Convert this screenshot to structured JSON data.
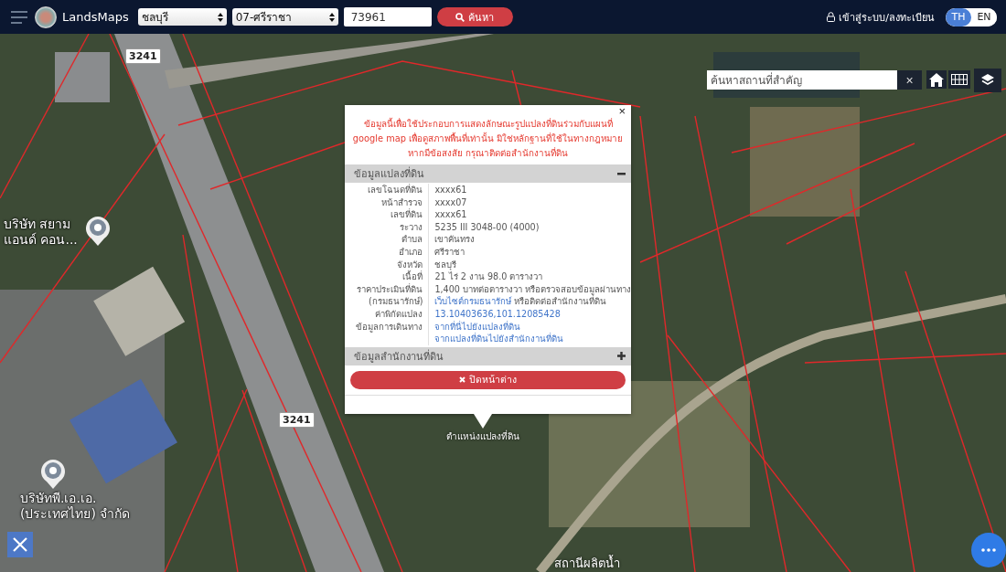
{
  "header": {
    "logo_text": "LandsMaps",
    "province_select": "ชลบุรี",
    "district_select": "07-ศรีราชา",
    "parcel_field": "73961",
    "search_button": "ค้นหา",
    "login_link": "เข้าสู่ระบบ/ลงทะเบียน",
    "languages": [
      {
        "label": "TH",
        "selected": true
      },
      {
        "label": "EN",
        "selected": false
      }
    ]
  },
  "map": {
    "place_search": {
      "placeholder": "ค้นหาสถานที่สำคัญ",
      "clear": "×"
    },
    "labels": [
      {
        "kind": "road",
        "text": "3241"
      },
      {
        "kind": "poi",
        "text": "บริษัท สยาม แอนด์ คอน..."
      },
      {
        "kind": "road",
        "text": "3241"
      },
      {
        "kind": "poi",
        "text": "บริษัทพี.เอ.เอ. (ประเทศไทย) จำกัด"
      },
      {
        "kind": "place",
        "text": "สถานีผลิตน้ำ"
      }
    ],
    "marker_label": "ตำแหน่งแปลงที่ดิน"
  },
  "popup": {
    "close": "×",
    "notice": "ข้อมูลนี้เพื่อใช้ประกอบการแสดงลักษณะรูปแปลงที่ดินร่วมกับแผนที่ google map เพื่อดูสภาพพื้นที่เท่านั้น มิใช่หลักฐานที่ใช้ในทางกฎหมาย หากมีข้อสงสัย กรุณาติดต่อสำนักงานที่ดิน",
    "sections": [
      {
        "title": "ข้อมูลแปลงที่ดิน",
        "expanded": true,
        "rows": [
          {
            "label": "เลขโฉนดที่ดิน",
            "value": [
              {
                "kind": "text",
                "text": "xxxx61"
              }
            ]
          },
          {
            "label": "หน้าสำรวจ",
            "value": [
              {
                "kind": "text",
                "text": "xxxx07"
              }
            ]
          },
          {
            "label": "เลขที่ดิน",
            "value": [
              {
                "kind": "text",
                "text": "xxxx61"
              }
            ]
          },
          {
            "label": "ระวาง",
            "value": [
              {
                "kind": "text",
                "text": "5235 III 3048-00 (4000)"
              }
            ]
          },
          {
            "label": "ตำบล",
            "value": [
              {
                "kind": "text",
                "text": "เขาคันทรง"
              }
            ]
          },
          {
            "label": "อำเภอ",
            "value": [
              {
                "kind": "text",
                "text": "ศรีราชา"
              }
            ]
          },
          {
            "label": "จังหวัด",
            "value": [
              {
                "kind": "text",
                "text": "ชลบุรี"
              }
            ]
          },
          {
            "label": "เนื้อที่",
            "value": [
              {
                "kind": "text",
                "text": "21 ไร่ 2 งาน 98.0 ตารางวา"
              }
            ]
          },
          {
            "label": "ราคาประเมินที่ดิน",
            "value": [
              {
                "kind": "text",
                "text": "1,400 บาทต่อตารางวา หรือตรวจสอบข้อมูลผ่านทาง"
              }
            ]
          },
          {
            "label": "(กรมธนารักษ์)",
            "value": [
              {
                "kind": "link",
                "text": "เว็บไซต์กรมธนารักษ์"
              },
              {
                "kind": "text",
                "text": " หรือติดต่อสำนักงานที่ดิน"
              }
            ]
          },
          {
            "label": "ค่าพิกัดแปลง",
            "value": [
              {
                "kind": "link",
                "text": "13.10403636,101.12085428"
              }
            ]
          },
          {
            "label": "ข้อมูลการเดินทาง",
            "value": [
              {
                "kind": "link",
                "text": "จากที่นี่ไปยังแปลงที่ดิน"
              }
            ]
          },
          {
            "value": [
              {
                "kind": "link",
                "text": "จากแปลงที่ดินไปยังสำนักงานที่ดิน"
              }
            ]
          }
        ]
      },
      {
        "title": "ข้อมูลสำนักงานที่ดิน",
        "expanded": false
      }
    ],
    "close_button": "ปิดหน้าต่าง"
  }
}
